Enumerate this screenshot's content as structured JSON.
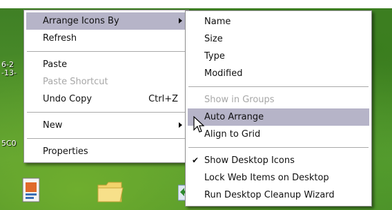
{
  "desktop": {
    "fragments": [
      "6-2",
      "-13-",
      "5C0"
    ],
    "icons": [
      {
        "name": "document-icon"
      },
      {
        "name": "folder-icon"
      },
      {
        "name": "shortcut-icon"
      }
    ]
  },
  "context_menu": {
    "items": [
      {
        "label": "Arrange Icons By",
        "has_submenu": true,
        "highlighted": true
      },
      {
        "label": "Refresh"
      },
      {
        "separator": true
      },
      {
        "label": "Paste"
      },
      {
        "label": "Paste Shortcut",
        "disabled": true
      },
      {
        "label": "Undo Copy",
        "shortcut": "Ctrl+Z"
      },
      {
        "separator": true
      },
      {
        "label": "New",
        "has_submenu": true
      },
      {
        "separator": true
      },
      {
        "label": "Properties"
      }
    ]
  },
  "submenu": {
    "items": [
      {
        "label": "Name"
      },
      {
        "label": "Size"
      },
      {
        "label": "Type"
      },
      {
        "label": "Modified"
      },
      {
        "separator": true
      },
      {
        "label": "Show in Groups",
        "disabled": true
      },
      {
        "label": "Auto Arrange",
        "highlighted": true
      },
      {
        "label": "Align to Grid"
      },
      {
        "separator": true
      },
      {
        "label": "Show Desktop Icons",
        "checked": true
      },
      {
        "label": "Lock Web Items on Desktop"
      },
      {
        "label": "Run Desktop Cleanup Wizard"
      }
    ]
  },
  "colors": {
    "highlight": "#b6b4c8",
    "disabled_text": "#a7a7a7"
  }
}
